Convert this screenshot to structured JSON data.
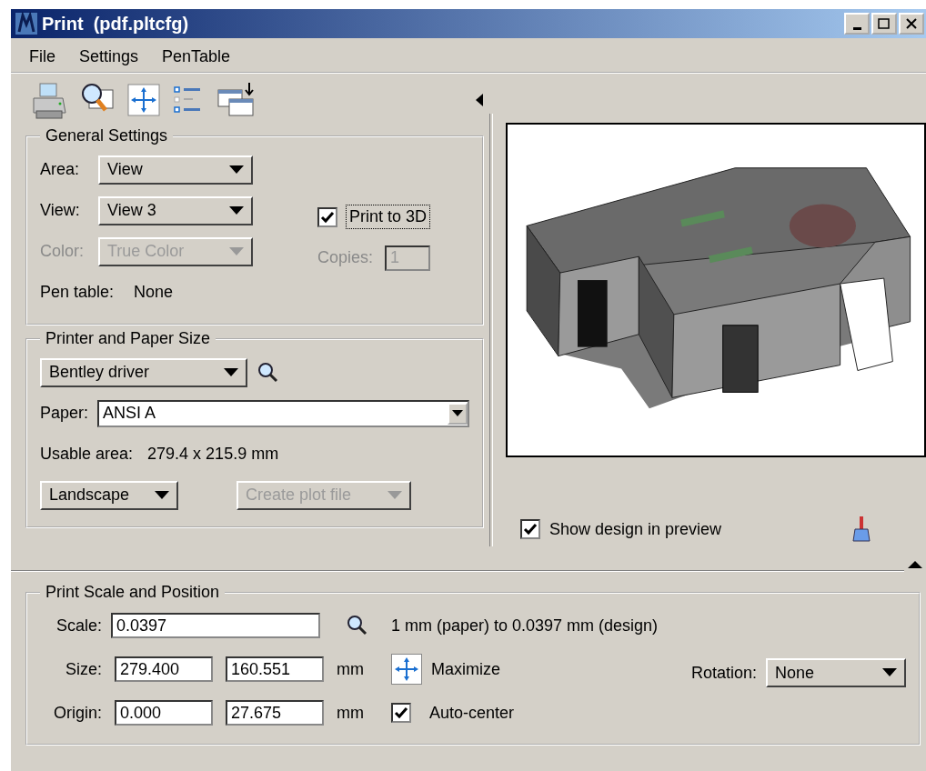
{
  "window": {
    "title": "Print  (pdf.pltcfg)"
  },
  "menu": [
    "File",
    "Settings",
    "PenTable"
  ],
  "general_settings": {
    "title": "General Settings",
    "dropdowns": [
      {
        "label": "Area:",
        "value": "View",
        "disabled": false
      },
      {
        "label": "View:",
        "value": "View 3",
        "disabled": false
      },
      {
        "label": "Color:",
        "value": "True Color",
        "disabled": true
      }
    ],
    "print_3d": {
      "label": "Print to 3D",
      "checked": true
    },
    "copies": {
      "label": "Copies:",
      "value": "1",
      "disabled": true
    },
    "pen_table": {
      "label": "Pen table:",
      "value": "None"
    }
  },
  "printer": {
    "title": "Printer and Paper Size",
    "driver": "Bentley driver",
    "paper_label": "Paper:",
    "paper": "ANSI A",
    "usable_label": "Usable area:",
    "usable_value": "279.4 x 215.9 mm",
    "orientation": "Landscape",
    "plot_file": {
      "label": "Create plot file",
      "disabled": true
    }
  },
  "preview": {
    "show_design": {
      "label": "Show design in preview",
      "checked": true
    }
  },
  "scale": {
    "title": "Print Scale and Position",
    "scale_label": "Scale:",
    "scale_value": "0.0397",
    "scale_text": "1 mm (paper) to 0.0397 mm (design)",
    "rows": [
      {
        "label": "Size:",
        "values": [
          "279.400",
          "160.551"
        ],
        "unit": "mm"
      },
      {
        "label": "Origin:",
        "values": [
          "0.000",
          "27.675"
        ],
        "unit": "mm"
      }
    ],
    "maximize": "Maximize",
    "auto_center": {
      "label": "Auto-center",
      "checked": true
    },
    "rotation_label": "Rotation:",
    "rotation": "None"
  }
}
